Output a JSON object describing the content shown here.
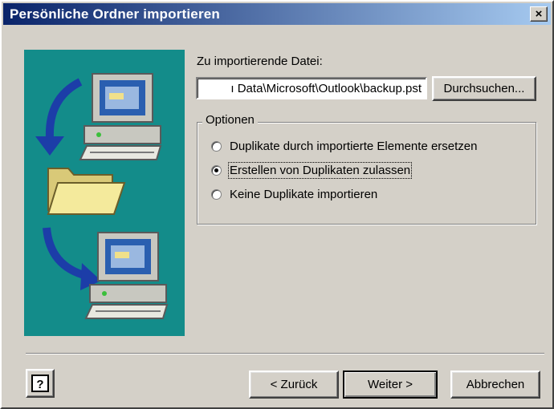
{
  "window": {
    "title": "Persönliche Ordner importieren",
    "close_glyph": "×"
  },
  "file": {
    "label": "Zu importierende Datei:",
    "value": "ı Data\\Microsoft\\Outlook\\backup.pst",
    "browse_label": "Durchsuchen..."
  },
  "options": {
    "legend": "Optionen",
    "items": [
      {
        "label": "Duplikate durch importierte Elemente ersetzen",
        "checked": false
      },
      {
        "label": "Erstellen von Duplikaten zulassen",
        "checked": true
      },
      {
        "label": "Keine Duplikate importieren",
        "checked": false
      }
    ]
  },
  "buttons": {
    "back": "< Zurück",
    "next": "Weiter >",
    "cancel": "Abbrechen"
  },
  "colors": {
    "title_start": "#0a246a",
    "title_end": "#a6caf0",
    "illustration_bg": "#138c8a",
    "dialog_bg": "#d4d0c8"
  },
  "icons": [
    "close-icon",
    "computer-icon",
    "folder-icon",
    "arrow-icon",
    "help-icon"
  ]
}
